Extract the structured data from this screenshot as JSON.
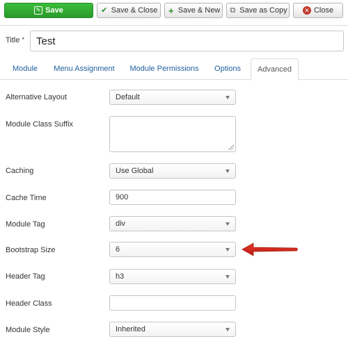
{
  "toolbar": {
    "save_label": "Save",
    "save_close_label": "Save & Close",
    "save_new_label": "Save & New",
    "save_copy_label": "Save as Copy",
    "close_label": "Close"
  },
  "title": {
    "label": "Title",
    "required_mark": "*",
    "value": "Test"
  },
  "tabs": [
    {
      "label": "Module",
      "active": false
    },
    {
      "label": "Menu Assignment",
      "active": false
    },
    {
      "label": "Module Permissions",
      "active": false
    },
    {
      "label": "Options",
      "active": false
    },
    {
      "label": "Advanced",
      "active": true
    }
  ],
  "form": {
    "alternative_layout": {
      "label": "Alternative Layout",
      "value": "Default"
    },
    "module_class_suffix": {
      "label": "Module Class Suffix",
      "value": ""
    },
    "caching": {
      "label": "Caching",
      "value": "Use Global"
    },
    "cache_time": {
      "label": "Cache Time",
      "value": "900"
    },
    "module_tag": {
      "label": "Module Tag",
      "value": "div"
    },
    "bootstrap_size": {
      "label": "Bootstrap Size",
      "value": "6"
    },
    "header_tag": {
      "label": "Header Tag",
      "value": "h3"
    },
    "header_class": {
      "label": "Header Class",
      "value": ""
    },
    "module_style": {
      "label": "Module Style",
      "value": "Inherited"
    }
  },
  "colors": {
    "primary_green": "#2fa52f",
    "tab_link": "#1f5f9e",
    "annotation_arrow": "#d9261c"
  }
}
